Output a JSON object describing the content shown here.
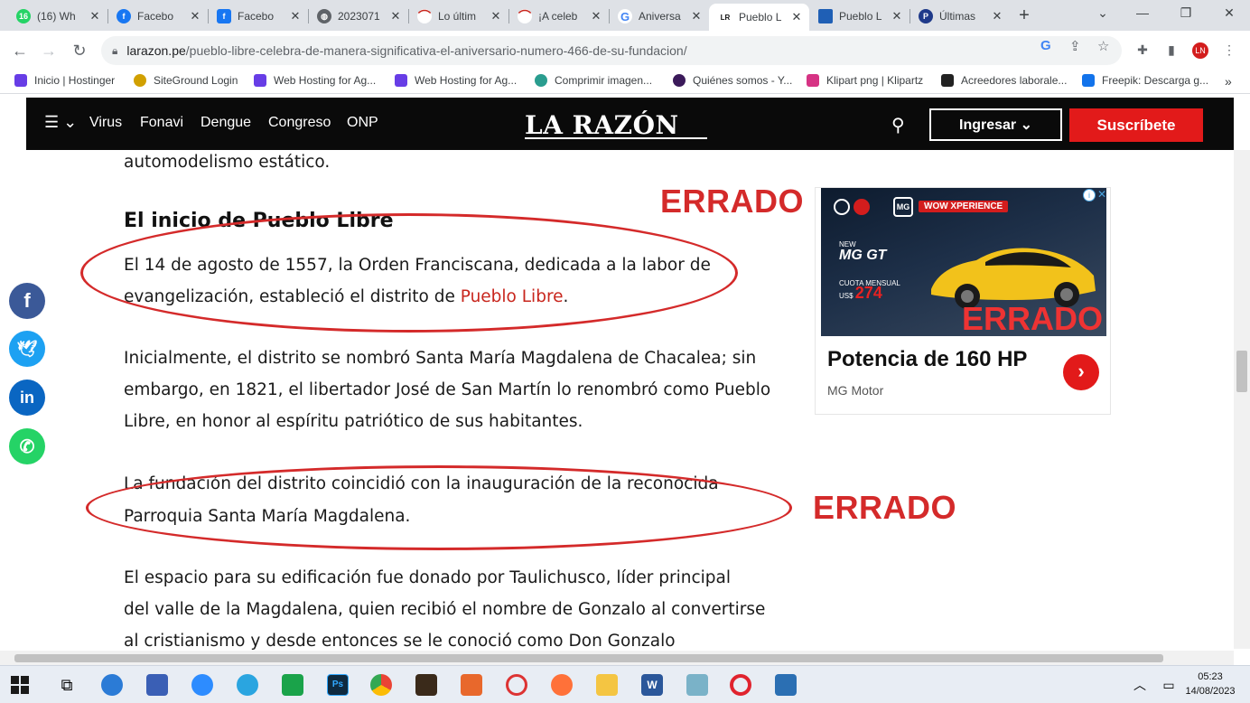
{
  "browser": {
    "tabs": [
      {
        "title": "(16) Wh",
        "icon": "whatsapp-icon",
        "color": "#25d366"
      },
      {
        "title": "Facebo",
        "icon": "facebook-icon",
        "color": "#1877f2"
      },
      {
        "title": "Facebo",
        "icon": "facebook-icon",
        "color": "#1877f2"
      },
      {
        "title": "2023071",
        "icon": "globe-icon",
        "color": "#5f6368"
      },
      {
        "title": "Lo últim",
        "icon": "site-icon",
        "color": "#c8261d"
      },
      {
        "title": "¡A celeb",
        "icon": "site-icon",
        "color": "#c8261d"
      },
      {
        "title": "Aniversa",
        "icon": "google-icon",
        "color": "#4285f4"
      },
      {
        "title": "Pueblo L",
        "icon": "larazon-icon",
        "color": "#111111"
      },
      {
        "title": "Pueblo L",
        "icon": "site-icon",
        "color": "#1f5fb5"
      },
      {
        "title": "Últimas",
        "icon": "site-icon",
        "color": "#1f3a8a"
      }
    ],
    "new_tab": "+",
    "url_domain": "larazon.pe",
    "url_path": "/pueblo-libre-celebra-de-manera-significativa-el-aniversario-numero-466-de-su-fundacion/",
    "bookmarks": [
      {
        "label": "Inicio | Hostinger",
        "color": "#673de6"
      },
      {
        "label": "SiteGround Login",
        "color": "#d1a000"
      },
      {
        "label": "Web Hosting for Ag...",
        "color": "#673de6"
      },
      {
        "label": "Web Hosting for Ag...",
        "color": "#673de6"
      },
      {
        "label": "Comprimir imagen...",
        "color": "#2a9d8f"
      },
      {
        "label": "Quiénes somos - Y...",
        "color": "#3b1a5a"
      },
      {
        "label": "Klipart png | Klipartz",
        "color": "#d63384"
      },
      {
        "label": "Acreedores laborale...",
        "color": "#222222"
      },
      {
        "label": "Freepik: Descarga g...",
        "color": "#1273eb"
      }
    ],
    "bookmarks_more": "»"
  },
  "site": {
    "nav": [
      "Virus",
      "Fonavi",
      "Dengue",
      "Congreso",
      "ONP"
    ],
    "menu_symbol": "☰ ⌄",
    "logo": "LA RAZÓN",
    "login": "Ingresar ⌄",
    "subscribe": "Suscríbete"
  },
  "article": {
    "line_top": "automodelismo estático.",
    "subhead": "El inicio de Pueblo Libre",
    "p1_line1": "El 14 de agosto de 1557, la Orden Franciscana, dedicada a la labor de",
    "p1_line2_pre": "evangelización, estableció el distrito de ",
    "p1_link": "Pueblo Libre",
    "p1_line2_post": ".",
    "p2_line1": "Inicialmente, el distrito se nombró Santa María Magdalena de Chacalea; sin",
    "p2_line2": "embargo, en 1821, el libertador José de San Martín lo renombró como Pueblo",
    "p2_line3": "Libre, en honor al espíritu patriótico de sus habitantes.",
    "p3_line1": "La fundación del distrito coincidió con la inauguración de la reconocida",
    "p3_line2": "Parroquia Santa María Magdalena.",
    "p4_line1": "El espacio para su edificación fue donado por Taulichusco, líder principal",
    "p4_line2": "del valle de la Magdalena, quien recibió el nombre de Gonzalo al convertirse",
    "p4_line3": "al cristianismo y desde entonces se le conoció como Don Gonzalo"
  },
  "annotations": {
    "errado1": "ERRADO",
    "errado2": "ERRADO",
    "errado3": "ERRADO",
    "color": "#d42a2a"
  },
  "share": [
    {
      "name": "facebook",
      "glyph": "f",
      "color": "#3b5998"
    },
    {
      "name": "twitter",
      "glyph": "t",
      "color": "#1da1f2"
    },
    {
      "name": "linkedin",
      "glyph": "in",
      "color": "#0a66c2"
    },
    {
      "name": "whatsapp",
      "glyph": "✆",
      "color": "#25d366"
    }
  ],
  "ad": {
    "tag": "WOW XPERIENCE",
    "new": "NEW",
    "model": "MG GT",
    "price_label": "CUOTA MENSUAL",
    "price_value": "274",
    "title": "Potencia de 160 HP",
    "advertiser": "MG Motor"
  },
  "taskbar": {
    "time": "05:23",
    "date": "14/08/2023"
  }
}
